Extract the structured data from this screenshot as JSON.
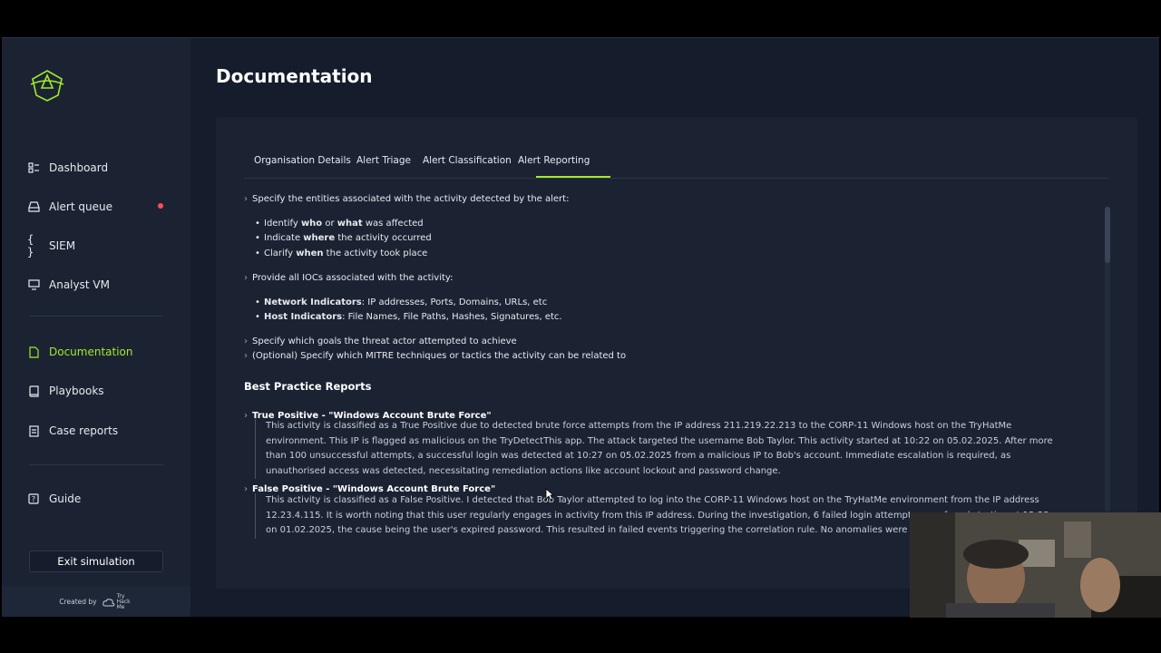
{
  "sidebar": {
    "items": [
      {
        "label": "Dashboard",
        "icon": "dashboard-icon"
      },
      {
        "label": "Alert queue",
        "icon": "inbox-icon"
      },
      {
        "label": "SIEM",
        "icon": "code-braces-icon"
      },
      {
        "label": "Analyst VM",
        "icon": "monitor-icon"
      },
      {
        "label": "Documentation",
        "icon": "document-icon"
      },
      {
        "label": "Playbooks",
        "icon": "book-icon"
      },
      {
        "label": "Case reports",
        "icon": "report-icon"
      },
      {
        "label": "Guide",
        "icon": "help-icon"
      }
    ],
    "exit_label": "Exit simulation",
    "footer_label": "Created by",
    "footer_brand": "Try Hack Me",
    "accent_color": "#a3ea2a",
    "alert_dot_color": "#ff4c5e"
  },
  "page": {
    "title": "Documentation"
  },
  "tabs": [
    {
      "label": "Organisation Details"
    },
    {
      "label": "Alert Triage"
    },
    {
      "label": "Alert Classification"
    },
    {
      "label": "Alert Reporting"
    }
  ],
  "content": {
    "entities_intro": "Specify the entities associated with the activity detected by the alert:",
    "entities": [
      {
        "pre": "Identify ",
        "b1": "who",
        "mid": " or ",
        "b2": "what",
        "post": " was affected"
      },
      {
        "pre": "Indicate ",
        "b1": "where",
        "post": " the activity occurred"
      },
      {
        "pre": "Clarify ",
        "b1": "when",
        "post": " the activity took place"
      }
    ],
    "iocs_intro": "Provide all IOCs associated with the activity:",
    "iocs": [
      {
        "label": "Network Indicators",
        "text": ": IP addresses, Ports, Domains, URLs, etc"
      },
      {
        "label": "Host Indicators",
        "text": ": File Names, File Paths, Hashes, Signatures, etc."
      }
    ],
    "goals": "Specify which goals the threat actor attempted to achieve",
    "mitre": "(Optional) Specify which MITRE techniques or tactics the activity can be related to",
    "best_practice_title": "Best Practice Reports",
    "reports": [
      {
        "title": "True Positive - \"Windows Account Brute Force\"",
        "body": "This activity is classified as a True Positive due to detected brute force attempts from the IP address 211.219.22.213 to the CORP-11 Windows host on the TryHatMe environment. This IP is flagged as malicious on the TryDetectThis app. The attack targeted the username Bob Taylor. This activity started at 10:22 on 05.02.2025. After more than 100 unsuccessful attempts, a successful login was detected at 10:27 on 05.02.2025 from a malicious IP to Bob's account. Immediate escalation is required, as unauthorised access was detected, necessitating remediation actions like account lockout and password change."
      },
      {
        "title": "False Positive - \"Windows Account Brute Force\"",
        "body": "This activity is classified as a False Positive. I detected that Bob Taylor attempted to log into the CORP-11 Windows host on the TryHatMe environment from the IP address 12.23.4.115. It is worth noting that this user regularly engages in activity from this IP address. During the investigation, 6 failed login attempts were found starting at 12:23 on 01.02.2025, the cause being the user's expired password. This resulted in failed events triggering the correlation rule. No anomalies were found."
      }
    ]
  }
}
